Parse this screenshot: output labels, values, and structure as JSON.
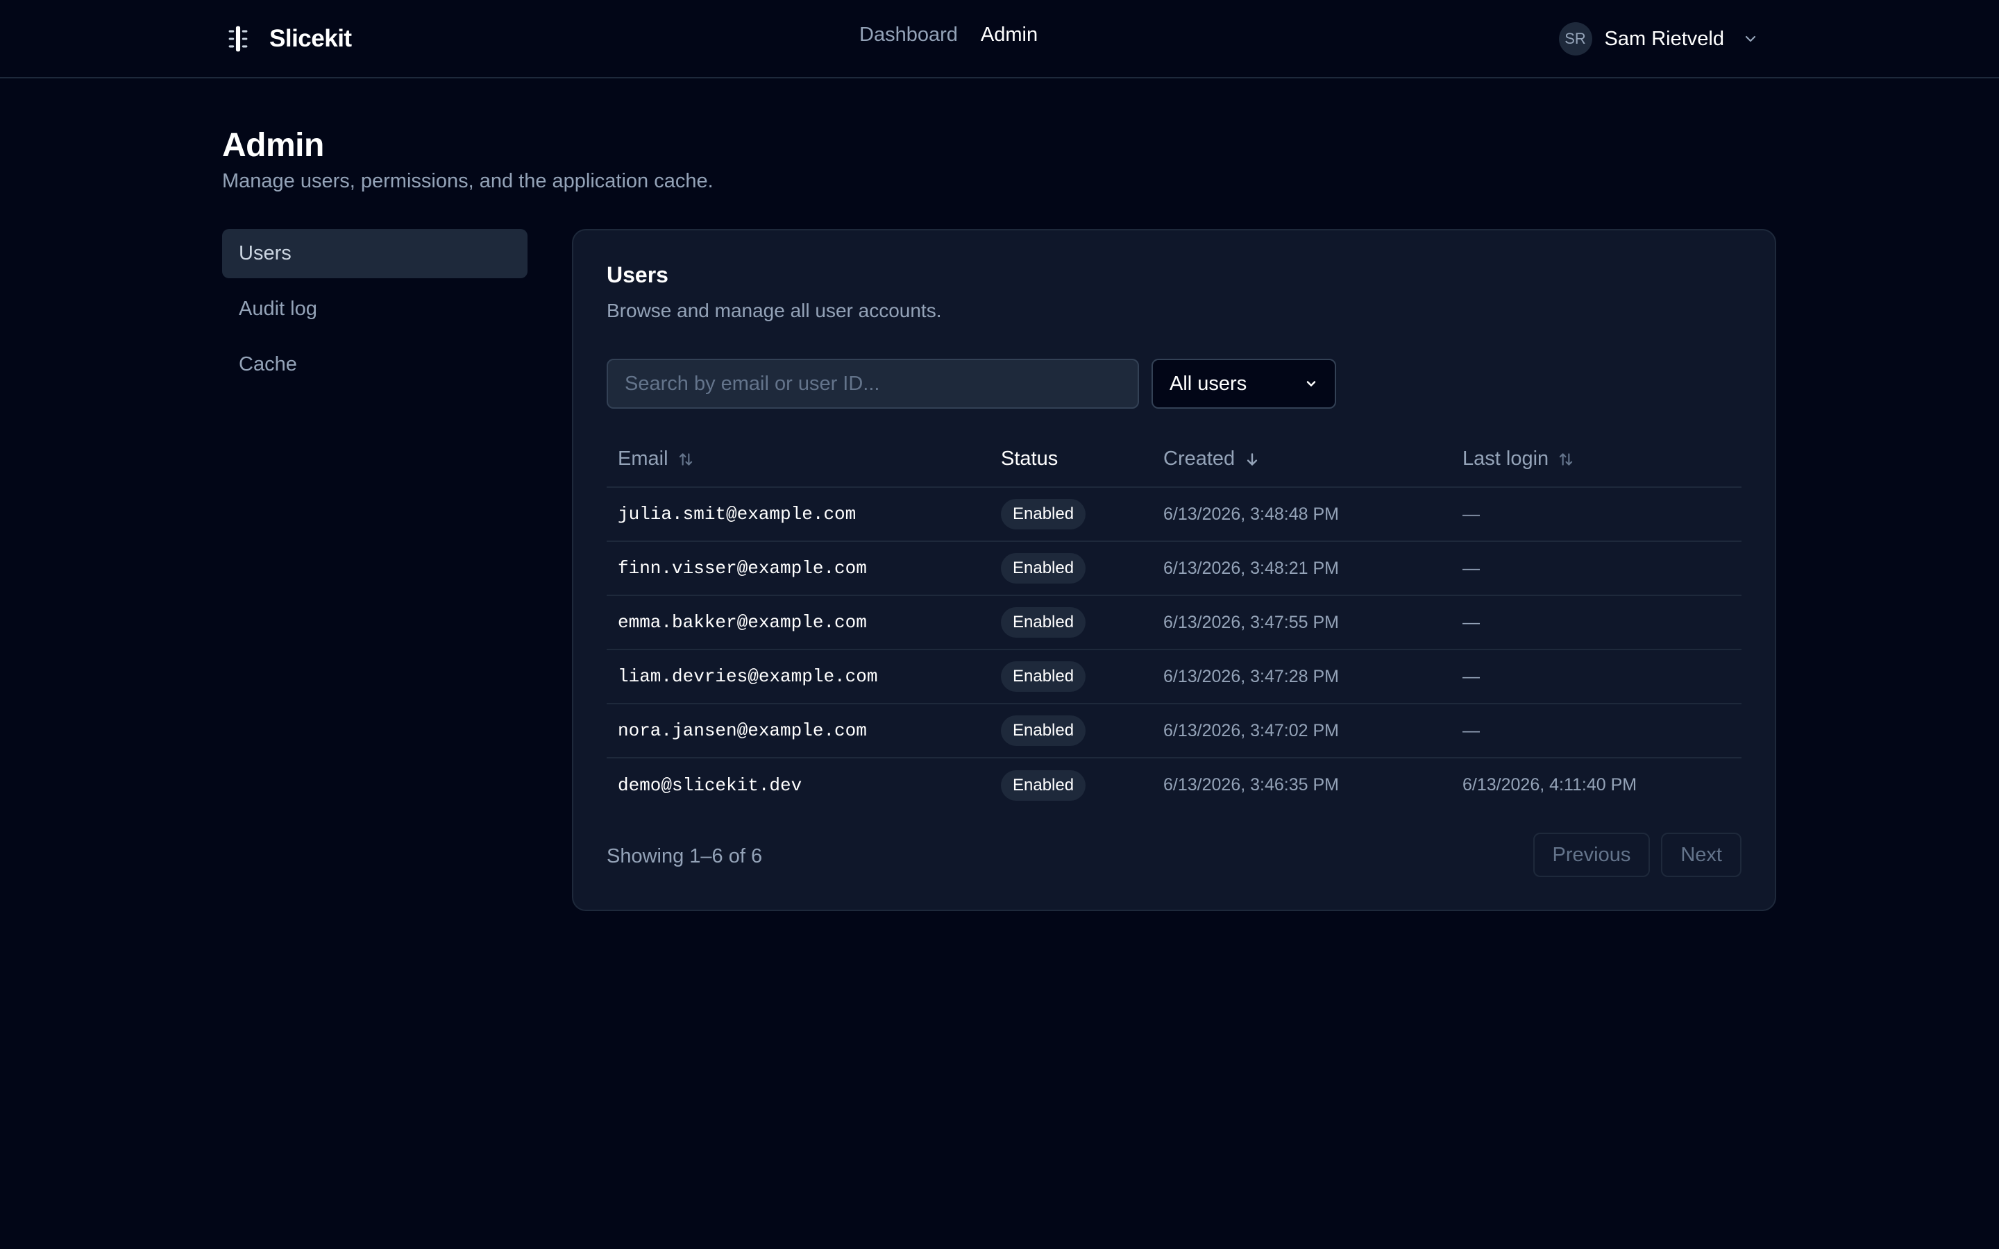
{
  "app": {
    "name": "Slicekit"
  },
  "topnav": {
    "items": [
      {
        "label": "Dashboard",
        "active": false
      },
      {
        "label": "Admin",
        "active": true
      }
    ]
  },
  "user": {
    "initials": "SR",
    "name": "Sam Rietveld"
  },
  "page": {
    "title": "Admin",
    "subtitle": "Manage users, permissions, and the application cache."
  },
  "sidebar": {
    "items": [
      {
        "label": "Users",
        "active": true
      },
      {
        "label": "Audit log",
        "active": false
      },
      {
        "label": "Cache",
        "active": false
      }
    ]
  },
  "users_card": {
    "title": "Users",
    "description": "Browse and manage all user accounts.",
    "search": {
      "placeholder": "Search by email or user ID...",
      "value": ""
    },
    "filter": {
      "selected": "All users"
    },
    "columns": {
      "email": "Email",
      "status": "Status",
      "created": "Created",
      "last_login": "Last login"
    },
    "rows": [
      {
        "email": "julia.smit@example.com",
        "status": "Enabled",
        "created": "6/13/2026, 3:48:48 PM",
        "last_login": "—"
      },
      {
        "email": "finn.visser@example.com",
        "status": "Enabled",
        "created": "6/13/2026, 3:48:21 PM",
        "last_login": "—"
      },
      {
        "email": "emma.bakker@example.com",
        "status": "Enabled",
        "created": "6/13/2026, 3:47:55 PM",
        "last_login": "—"
      },
      {
        "email": "liam.devries@example.com",
        "status": "Enabled",
        "created": "6/13/2026, 3:47:28 PM",
        "last_login": "—"
      },
      {
        "email": "nora.jansen@example.com",
        "status": "Enabled",
        "created": "6/13/2026, 3:47:02 PM",
        "last_login": "—"
      },
      {
        "email": "demo@slicekit.dev",
        "status": "Enabled",
        "created": "6/13/2026, 3:46:35 PM",
        "last_login": "6/13/2026, 4:11:40 PM"
      }
    ],
    "showing": "Showing 1–6 of 6",
    "pager": {
      "previous": "Previous",
      "next": "Next"
    }
  },
  "icons": {
    "logo": "slicekit-logo-icon",
    "user_menu": "chevron-down-icon",
    "email_sort": "sort-both-icon",
    "created_sort": "sort-descending-icon",
    "last_login_sort": "sort-both-icon",
    "filter": "chevron-down-icon"
  },
  "colors": {
    "background": "#020617",
    "card": "#0f172a",
    "border": "#1e293b",
    "muted_text": "#94a3b8",
    "primary_text": "#ffffff"
  }
}
